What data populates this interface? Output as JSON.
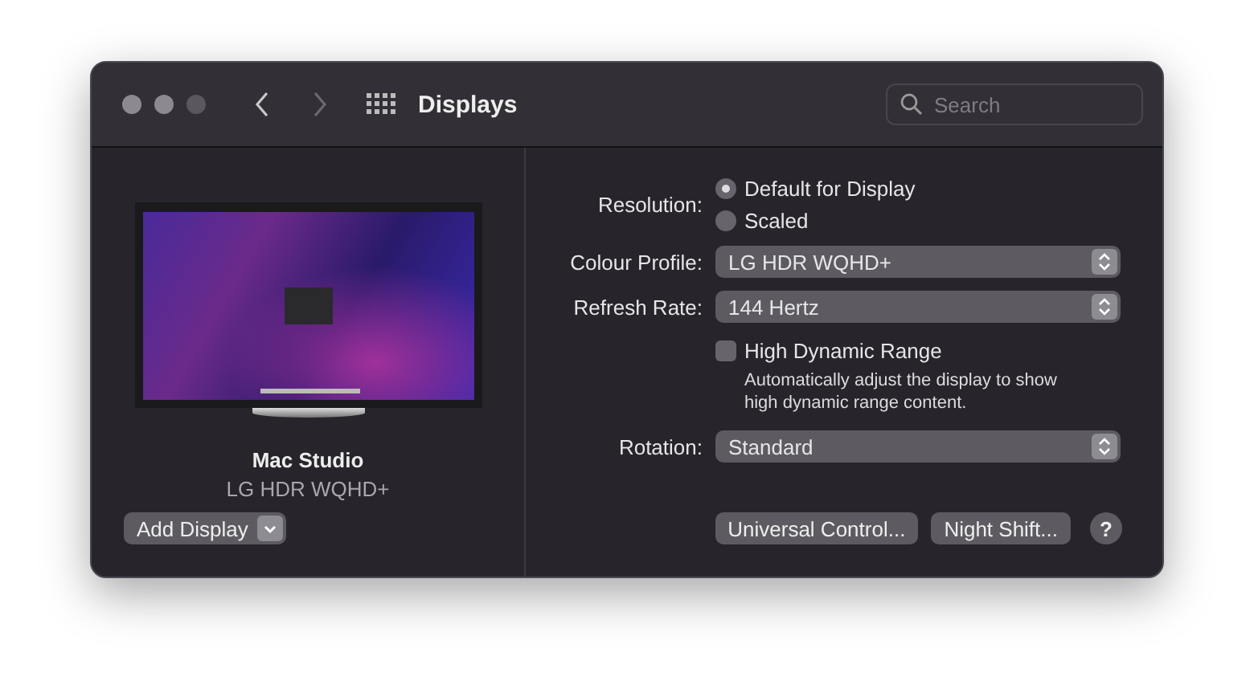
{
  "window": {
    "title": "Displays",
    "nav": [
      {
        "kind": "back",
        "disabled": false
      },
      {
        "kind": "forward",
        "disabled": true
      }
    ],
    "search": {
      "placeholder": "Search"
    }
  },
  "display": {
    "name": "Mac Studio",
    "model": "LG HDR WQHD+"
  },
  "add_display": {
    "label": "Add Display"
  },
  "resolution": {
    "label": "Resolution:",
    "options": [
      {
        "label": "Default for Display",
        "selected": true
      },
      {
        "label": "Scaled",
        "selected": false
      }
    ]
  },
  "selects": [
    {
      "label": "Colour Profile:",
      "value": "LG HDR WQHD+"
    },
    {
      "label": "Refresh Rate:",
      "value": "144 Hertz"
    }
  ],
  "hdr": {
    "label": "High Dynamic Range",
    "checked": false,
    "description": "Automatically adjust the display to show high dynamic range content."
  },
  "rotation": {
    "label": "Rotation:",
    "value": "Standard"
  },
  "buttons": [
    "Universal Control...",
    "Night Shift..."
  ],
  "help": "?"
}
